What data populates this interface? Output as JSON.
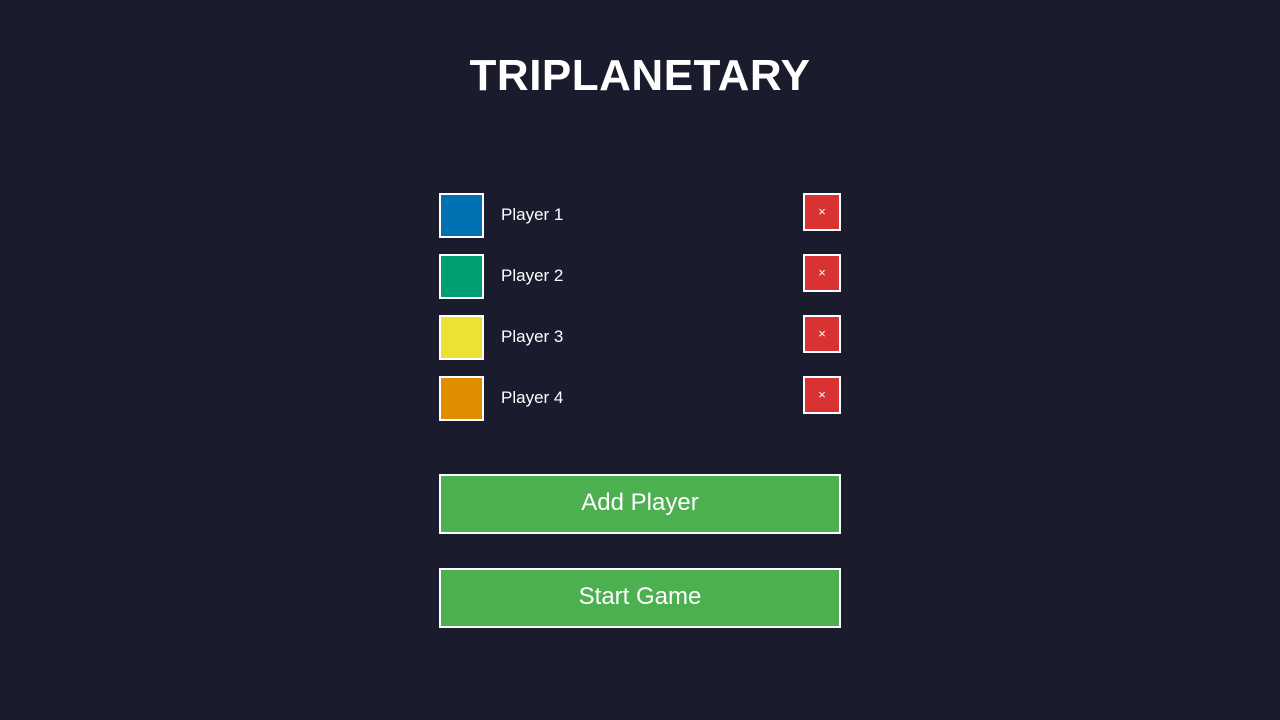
{
  "title": "TRIPLANETARY",
  "players": [
    {
      "name": "Player 1",
      "color": "#0072b2",
      "remove_label": "×"
    },
    {
      "name": "Player 2",
      "color": "#009e73",
      "remove_label": "×"
    },
    {
      "name": "Player 3",
      "color": "#ebe234",
      "remove_label": "×"
    },
    {
      "name": "Player 4",
      "color": "#e08e00",
      "remove_label": "×"
    }
  ],
  "colors": {
    "background": "#1b1b2e",
    "remove_button": "#d93232",
    "primary_button": "#4caf50"
  },
  "buttons": {
    "add_player": "Add Player",
    "start_game": "Start Game"
  }
}
